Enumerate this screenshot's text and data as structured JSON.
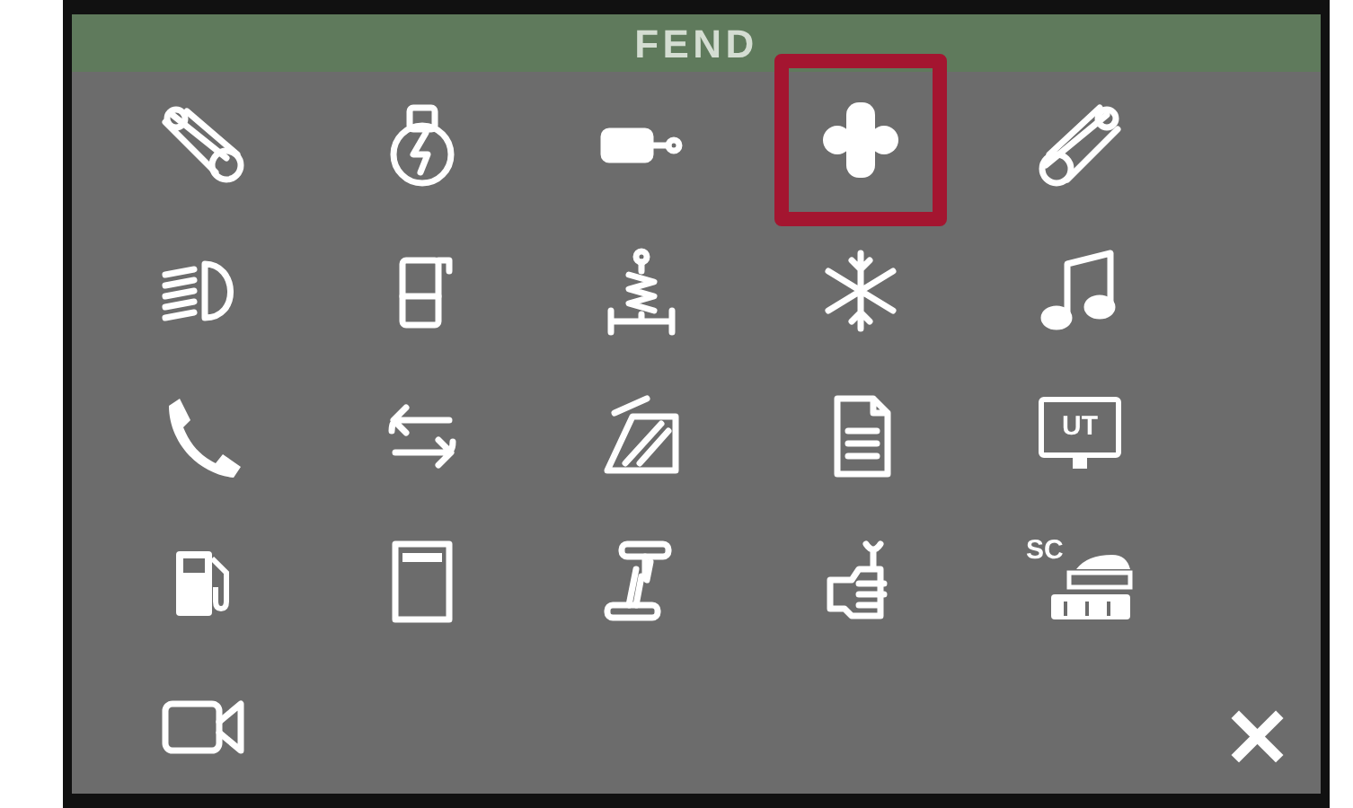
{
  "header": {
    "title": "FEND"
  },
  "menu": {
    "items": [
      {
        "kind": "lever",
        "selected": false
      },
      {
        "kind": "engine",
        "selected": false
      },
      {
        "kind": "cylinder",
        "selected": false
      },
      {
        "kind": "axle",
        "selected": true
      },
      {
        "kind": "lever-right",
        "selected": false
      },
      {
        "kind": "headlight",
        "selected": false
      },
      {
        "kind": "door",
        "selected": false
      },
      {
        "kind": "suspension",
        "selected": false
      },
      {
        "kind": "snowflake",
        "selected": false
      },
      {
        "kind": "music",
        "selected": false
      },
      {
        "kind": "phone",
        "selected": false
      },
      {
        "kind": "swap",
        "selected": false
      },
      {
        "kind": "wiper",
        "selected": false
      },
      {
        "kind": "document",
        "selected": false
      },
      {
        "kind": "terminal",
        "label": "UT",
        "selected": false
      },
      {
        "kind": "fuel",
        "selected": false
      },
      {
        "kind": "panel",
        "selected": false
      },
      {
        "kind": "hitch",
        "selected": false
      },
      {
        "kind": "service",
        "selected": false
      },
      {
        "kind": "section-control",
        "label": "SC",
        "selected": false
      },
      {
        "kind": "camera",
        "selected": false
      }
    ]
  },
  "close": {
    "glyph": "✕"
  }
}
